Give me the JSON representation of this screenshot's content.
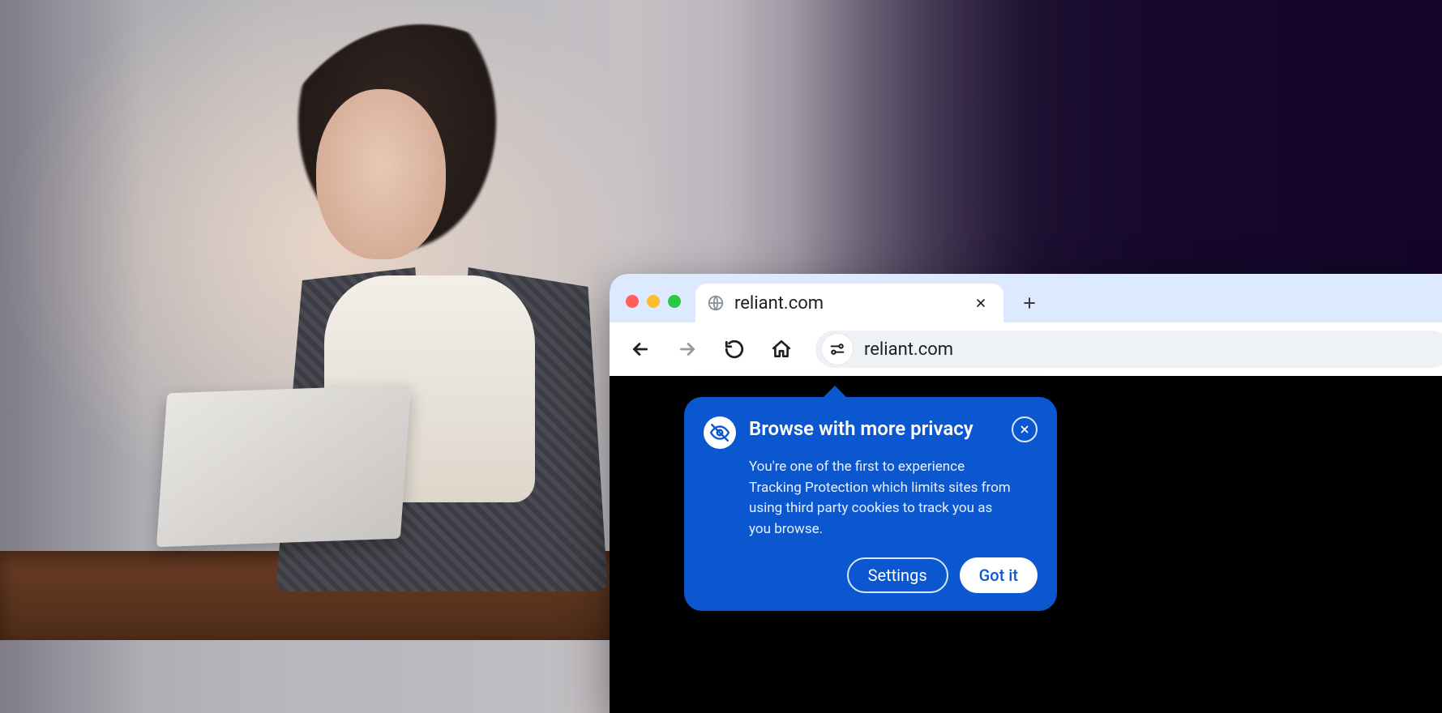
{
  "browser": {
    "tab": {
      "title": "reliant.com"
    },
    "omnibox": {
      "url": "reliant.com"
    }
  },
  "callout": {
    "title": "Browse with more privacy",
    "body": "You're one of the first to experience Tracking Protection which limits sites from using third party cookies to track you as you browse.",
    "settings_label": "Settings",
    "confirm_label": "Got it"
  },
  "colors": {
    "accent": "#0b57d0"
  }
}
